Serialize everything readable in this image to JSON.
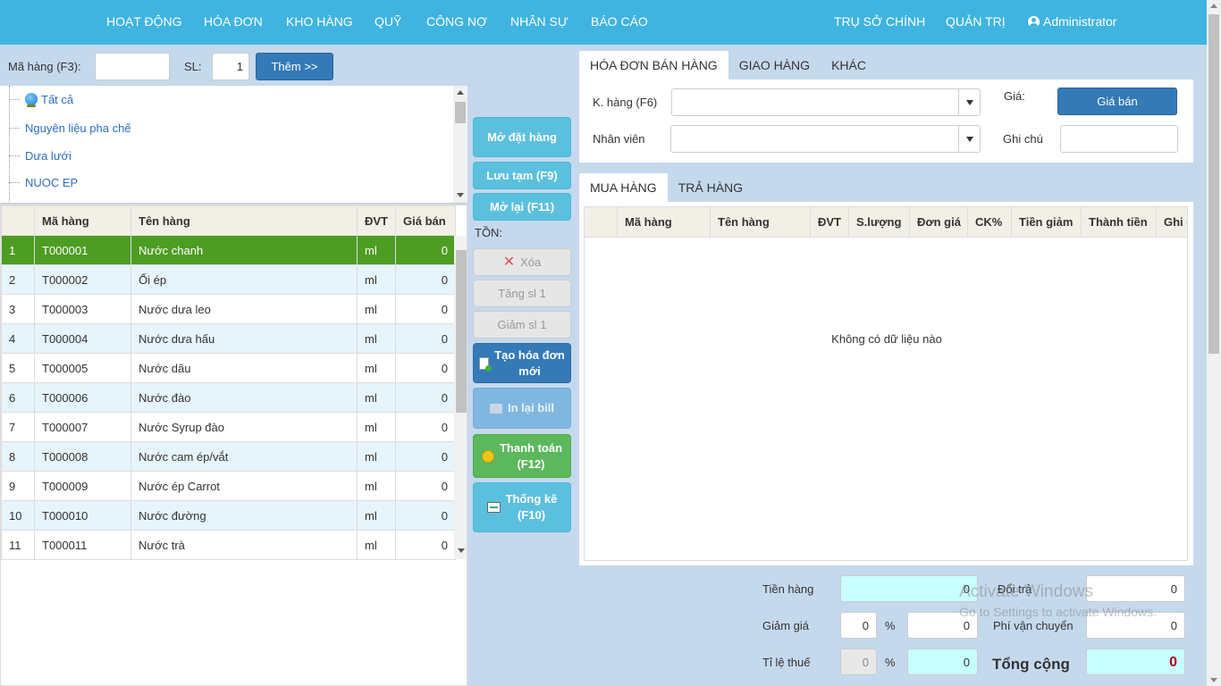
{
  "nav": {
    "items": [
      "HOẠT ĐỘNG",
      "HÓA ĐƠN",
      "KHO HÀNG",
      "QUỸ",
      "CÔNG NỢ",
      "NHÂN SỰ",
      "BÁO CÁO"
    ],
    "branch": "TRỤ SỞ CHÍNH",
    "admin": "QUẢN TRỊ",
    "user": "Administrator"
  },
  "search": {
    "code_label": "Mã hàng (F3):",
    "code_value": "",
    "qty_label": "SL:",
    "qty_value": "1",
    "add_button": "Thêm >>"
  },
  "tree": {
    "items": [
      "Tất cả",
      "Nguyên liệu pha chế",
      "Dưa lưới",
      "NUOC EP"
    ]
  },
  "products": {
    "columns": [
      "",
      "Mã hàng",
      "Tên hàng",
      "ĐVT",
      "Giá bán"
    ],
    "rows": [
      [
        "1",
        "T000001",
        "Nước chanh",
        "ml",
        "0"
      ],
      [
        "2",
        "T000002",
        "Ổi ép",
        "ml",
        "0"
      ],
      [
        "3",
        "T000003",
        "Nước dưa leo",
        "ml",
        "0"
      ],
      [
        "4",
        "T000004",
        "Nước dưa hấu",
        "ml",
        "0"
      ],
      [
        "5",
        "T000005",
        "Nước dâu",
        "ml",
        "0"
      ],
      [
        "6",
        "T000006",
        "Nước đào",
        "ml",
        "0"
      ],
      [
        "7",
        "T000007",
        "Nước Syrup đào",
        "ml",
        "0"
      ],
      [
        "8",
        "T000008",
        "Nước cam ép/vắt",
        "ml",
        "0"
      ],
      [
        "9",
        "T000009",
        "Nước ép Carrot",
        "ml",
        "0"
      ],
      [
        "10",
        "T000010",
        "Nước đường",
        "ml",
        "0"
      ],
      [
        "11",
        "T000011",
        "Nước trà",
        "ml",
        "0"
      ]
    ],
    "selected_index": 0
  },
  "actions": {
    "open_order": "Mở đặt hàng",
    "save_temp": "Lưu tạm (F9)",
    "reopen": "Mở lại (F11)",
    "stock_label": "TỒN:",
    "delete": "Xóa",
    "inc_qty": "Tăng sl 1",
    "dec_qty": "Giảm sl 1",
    "new_invoice_1": "Tạo hóa đơn",
    "new_invoice_2": "mới",
    "reprint": "In lại bill",
    "pay_1": "Thanh toán",
    "pay_2": "(F12)",
    "stats_1": "Thống kê",
    "stats_2": "(F10)"
  },
  "invoice_tabs": [
    "HÓA ĐƠN BÁN HÀNG",
    "GIAO HÀNG",
    "KHÁC"
  ],
  "invoice": {
    "customer_label": "K. hàng (F6)",
    "staff_label": "Nhân viên",
    "price_label": "Giá:",
    "price_button": "Giá bán",
    "note_label": "Ghi chú"
  },
  "order_tabs": [
    "MUA HÀNG",
    "TRẢ HÀNG"
  ],
  "order_grid": {
    "columns": [
      "",
      "Mã hàng",
      "Tên hàng",
      "ĐVT",
      "S.lượng",
      "Đơn giá",
      "CK%",
      "Tiền giảm",
      "Thành tiền",
      "Ghi chú"
    ],
    "empty_text": "Không có dữ liệu nào"
  },
  "summary": {
    "goods_label": "Tiền hàng",
    "goods_value": "0",
    "return_label": "Đổi trả",
    "return_value": "0",
    "discount_label": "Giảm giá",
    "discount_pct": "0",
    "discount_value": "0",
    "shipping_label": "Phí vận chuyển",
    "shipping_value": "0",
    "tax_label": "Tỉ lệ thuế",
    "tax_pct": "0",
    "tax_value": "0",
    "total_label": "Tổng cộng",
    "total_value": "0",
    "pct_symbol": "%"
  },
  "watermark": {
    "line1": "Activate Windows",
    "line2": "Go to Settings to activate Windows."
  }
}
